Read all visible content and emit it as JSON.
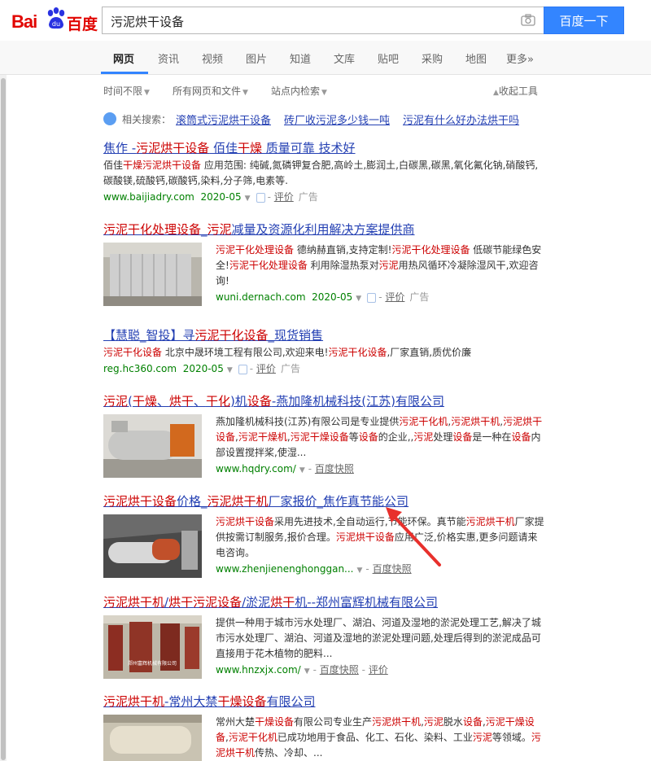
{
  "header": {
    "logo_text": "Bai",
    "logo_cn": "百度",
    "logo_paw_text": "du",
    "query": "污泥烘干设备",
    "search_button": "百度一下"
  },
  "nav": {
    "tabs": [
      "网页",
      "资讯",
      "视频",
      "图片",
      "知道",
      "文库",
      "贴吧",
      "采购",
      "地图",
      "更多»"
    ]
  },
  "tools": {
    "time": "时间不限",
    "type": "所有网页和文件",
    "site": "站点内检索",
    "collapse": "收起工具"
  },
  "related": {
    "label": "相关搜索：",
    "items": [
      "滚筒式污泥烘干设备",
      "砖厂收污泥多少钱一吨",
      "污泥有什么好办法烘干吗"
    ]
  },
  "results": [
    {
      "title": "焦作 -污泥烘干设备 佰佳干燥 质量可靠 技术好",
      "abstract": "佰佳干燥污泥烘干设备 应用范围: 纯碱,氮磷钾复合肥,高岭土,膨润土,白碳黑,碳黑,氧化氟化钠,硝酸钙,碳酸镁,硫酸钙,碳酸钙,染料,分子筛,电素等.",
      "url": "www.baijiadry.com",
      "date": "2020-05",
      "review": "评价",
      "ad": "广告"
    },
    {
      "title": "污泥干化处理设备_污泥减量及资源化利用解决方案提供商",
      "abstract": "污泥干化处理设备 德纳赫直销,支持定制!污泥干化处理设备 低碳节能绿色安全!污泥干化处理设备 利用除湿热泵对污泥用热风循环冷凝除湿风干,欢迎咨询!",
      "url": "wuni.dernach.com",
      "date": "2020-05",
      "review": "评价",
      "ad": "广告"
    },
    {
      "title": "【慧聪_智投】寻污泥干化设备_现货销售",
      "abstract": "污泥干化设备 北京中晟环境工程有限公司,欢迎来电!污泥干化设备,厂家直销,质优价廉",
      "url": "reg.hc360.com",
      "date": "2020-05",
      "review": "评价",
      "ad": "广告"
    },
    {
      "title": "污泥(干燥、烘干、干化)机设备-燕加隆机械科技(江苏)有限公司",
      "abstract": "燕加隆机械科技(江苏)有限公司是专业提供污泥干化机,污泥烘干机,污泥烘干设备,污泥干燥机,污泥干燥设备等设备的企业,,污泥处理设备是一种在设备内部设置搅拌桨,使湿...",
      "url": "www.hqdry.com/",
      "snapshot": "百度快照"
    },
    {
      "title": "污泥烘干设备价格_污泥烘干机厂家报价_焦作真节能公司",
      "abstract": "污泥烘干设备采用先进技术,全自动运行,节能环保。真节能污泥烘干机厂家提供按需订制服务,报价合理。污泥烘干设备应用广泛,价格实惠,更多问题请来电咨询。",
      "url": "www.zhenjienenghonggan...",
      "snapshot": "百度快照"
    },
    {
      "title": "污泥烘干机/烘干污泥设备/淤泥烘干机--郑州富辉机械有限公司",
      "abstract": "提供一种用于城市污水处理厂、湖泊、河道及湿地的淤泥处理工艺,解决了城市污水处理厂、湖泊、河道及湿地的淤泥处理问题,处理后得到的淤泥成品可直接用于花木植物的肥料...",
      "url": "www.hnzxjx.com/",
      "snapshot": "百度快照",
      "review": "评价",
      "image_caption": "郑州富辉机械有限公司"
    },
    {
      "title": "污泥烘干机-常州大禁干燥设备有限公司",
      "abstract": "常州大楚干燥设备有限公司专业生产污泥烘干机,污泥脱水设备,污泥干燥设备,污泥干化机已成功地用于食品、化工、石化、染料、工业污泥等领域。污泥烘干机传热、冷却、...",
      "url": "",
      "snapshot": ""
    }
  ],
  "colors": {
    "link": "#2440b3",
    "highlight": "#c00",
    "url": "#008000",
    "button": "#3385ff"
  }
}
